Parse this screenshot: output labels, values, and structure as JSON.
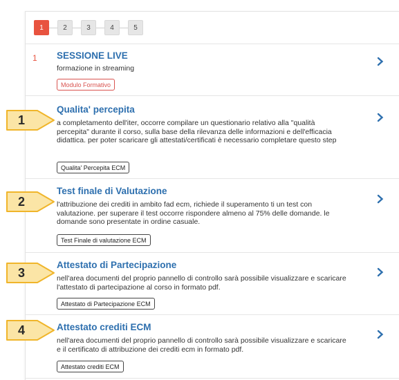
{
  "stepper": {
    "steps": [
      "1",
      "2",
      "3",
      "4",
      "5"
    ],
    "active_step": "1"
  },
  "rows": [
    {
      "number": "1",
      "title": "SESSIONE LIVE",
      "description": "formazione in streaming",
      "badge": "Modulo Formativo"
    },
    {
      "title": "Qualita' percepita",
      "description": "a completamento dell'iter, occorre compilare un questionario relativo alla \"qualità percepita\" durante il corso, sulla base della rilevanza delle informazioni e dell'efficacia didattica. per poter scaricare gli attestati/certificati è necessario completare questo step",
      "badge": "Qualita' Percepita ECM"
    },
    {
      "title": "Test finale di Valutazione",
      "description": "l'attribuzione dei crediti in ambito fad ecm, richiede il superamento ti un test con valutazione. per superare il test occorre rispondere almeno al 75% delle domande. le domande sono presentate in ordine casuale.",
      "badge": "Test Finale di valutazione ECM"
    },
    {
      "title": "Attestato di Partecipazione",
      "description": "nell'area documenti del proprio pannello di controllo sarà possibile visualizzare e scaricare l'attestato di partecipazione al corso in formato pdf.",
      "badge": "Attestato di Partecipazione ECM"
    },
    {
      "title": "Attestato crediti ECM",
      "description": "nell'area documenti del proprio pannello di controllo sarà possibile visualizzare e scaricare e il certificato di attribuzione dei crediti ecm in formato pdf.",
      "badge": "Attestato crediti ECM"
    }
  ],
  "callouts": [
    "1",
    "2",
    "3",
    "4"
  ],
  "colors": {
    "accent": "#2d6fae",
    "active_step": "#e8533f",
    "callout_fill": "#fbe5a6",
    "callout_border": "#f0b52a"
  },
  "icons": {
    "row_chevron": "chevron-right-icon"
  }
}
